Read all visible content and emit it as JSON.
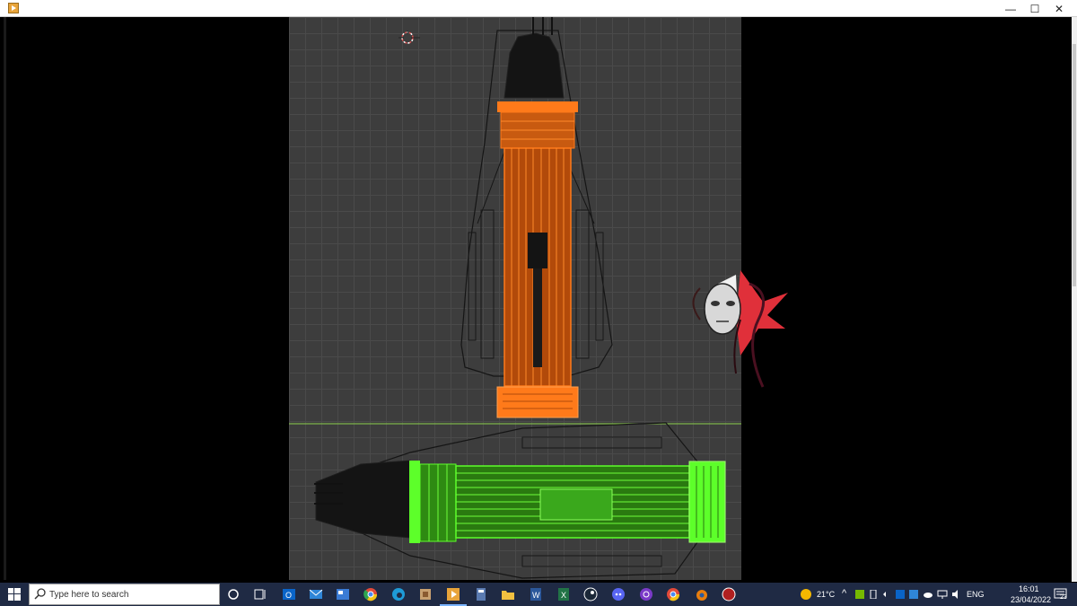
{
  "window": {
    "buttons": {
      "minimize": "—",
      "maximize": "☐",
      "close": "✕"
    }
  },
  "viewport": {
    "background": "#3d3d3d",
    "grid": true,
    "horizon_color": "#8bd04a"
  },
  "models": {
    "top": {
      "color": "#ff7a1a"
    },
    "bottom": {
      "color": "#5dff2a"
    }
  },
  "overlay_logo": {
    "name": "mask-logo"
  },
  "taskbar": {
    "search_placeholder": "Type here to search",
    "apps": [
      "task-view",
      "widgets",
      "outlook",
      "mail",
      "news",
      "chrome",
      "edge",
      "photos",
      "media-player",
      "calculator",
      "file-explorer",
      "word",
      "excel",
      "steam",
      "discord",
      "podcast",
      "chrome-2",
      "blender",
      "other-app"
    ],
    "tray": {
      "weather": "21°C",
      "language": "ENG",
      "time": "16:01",
      "date": "23/04/2022",
      "notifications": "23"
    }
  }
}
